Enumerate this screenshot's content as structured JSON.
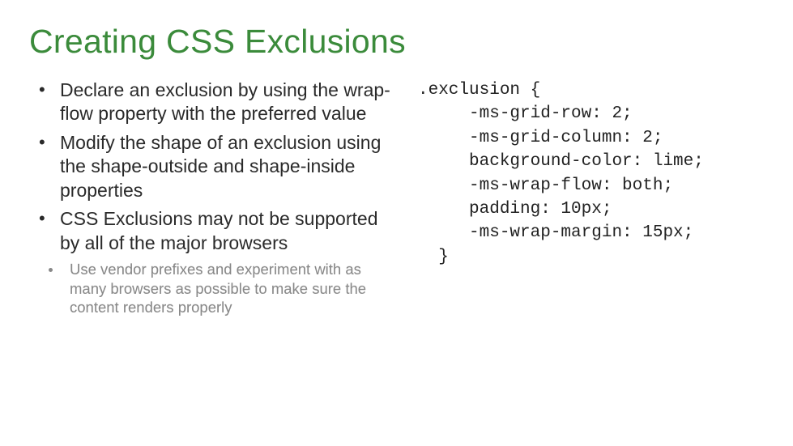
{
  "title": "Creating CSS Exclusions",
  "bullets": [
    {
      "pre": "Declare an exclusion by using the ",
      "term": "wrap-flow",
      "post": " property with the preferred value"
    },
    {
      "pre": "Modify the shape of an exclusion using the ",
      "term": "shape-outside",
      "mid": " and ",
      "term2": "shape-inside",
      "post": " properties"
    },
    {
      "pre": "CSS Exclusions may not be supported by all of the major browsers",
      "term": "",
      "post": ""
    }
  ],
  "sub": "Use vendor prefixes and experiment with as many browsers as possible to make sure the content renders properly",
  "code": {
    "l1": ".exclusion {",
    "l2": "     -ms-grid-row: 2;",
    "l3": "     -ms-grid-column: 2;",
    "l4": "     background-color: lime;",
    "l5": "     -ms-wrap-flow: both;",
    "l6": "     padding: 10px;",
    "l7": "     -ms-wrap-margin: 15px;",
    "l8": "  }"
  }
}
